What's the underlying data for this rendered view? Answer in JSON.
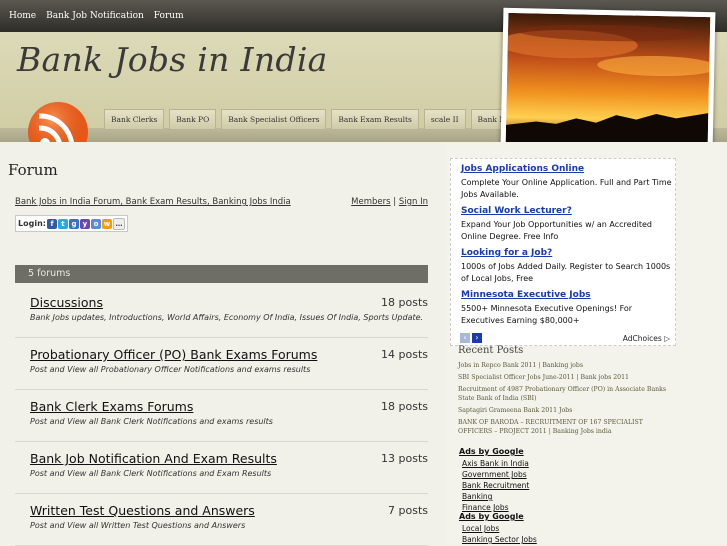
{
  "topnav": [
    "Home",
    "Bank Job Notification",
    "Forum"
  ],
  "header": {
    "site_title": "Bank Jobs in India",
    "categories": [
      "Bank Clerks",
      "Bank PO",
      "Bank Specialist Officers",
      "Bank Exam Results",
      "scale II",
      "Bank Manager"
    ]
  },
  "main": {
    "page_title": "Forum",
    "breadcrumb": "Bank Jobs in India Forum, Bank Exam Results, Banking Jobs India",
    "members_label": "Members",
    "separator": "|",
    "signin_label": "Sign In",
    "login_label": "Login:",
    "forums_header": "5 forums",
    "forums": [
      {
        "title": "Discussions",
        "desc": "Bank Jobs updates, Introductions, World Affairs, Economy Of India, Issues Of India, Sports Update.",
        "posts": "18 posts"
      },
      {
        "title": "Probationary Officer (PO) Bank Exams Forums",
        "desc": "Post and View all Probationary Officer Notifications and exams results",
        "posts": "14 posts"
      },
      {
        "title": "Bank Clerk Exams Forums",
        "desc": "Post and View all Bank Clerk Notifications and exams results",
        "posts": "18 posts"
      },
      {
        "title": "Bank Job Notification And Exam Results",
        "desc": "Post and View all Bank Clerk Notifications and Exam Results",
        "posts": "13 posts"
      },
      {
        "title": "Written Test Questions and Answers",
        "desc": "Post and View all Written Test Questions and Answers",
        "posts": "7 posts"
      }
    ]
  },
  "sidebar": {
    "ads": [
      {
        "title": "Jobs Applications Online",
        "body": "Complete Your Online Application. Full and Part Time Jobs Available."
      },
      {
        "title": "Social Work Lecturer?",
        "body": "Expand Your Job Opportunities w/ an Accredited Online Degree. Free Info"
      },
      {
        "title": "Looking for a Job?",
        "body": "1000s of Jobs Added Daily. Register to Search 1000s of Local Jobs, Free"
      },
      {
        "title": "Minnesota Executive Jobs",
        "body": "5500+ Minnesota Executive Openings! For Executives Earning $80,000+"
      }
    ],
    "adchoices": "AdChoices",
    "recent_title": "Recent Posts",
    "recent_posts": [
      "Jobs in Repco Bank 2011 | Banking jobs",
      "SBI Specialist Officer Jobs June-2011 | Bank jobs 2011",
      "Recruitment of 4987 Probationary Officer (PO) in Associate Banks State Bank of India (SBI)",
      "Saptagiri Grameena Bank 2011 Jobs",
      "BANK OF BARODA – RECRUITMENT OF 167 SPECIALIST OFFICERS – PROJECT 2011 | Banking Jobs india"
    ],
    "ads_by_google_1": "Ads by Google",
    "google_links_1": [
      "Axis Bank in India",
      "Government Jobs",
      "Bank Recruitment",
      "Banking",
      "Finance Jobs"
    ],
    "ads_by_google_2": "Ads by Google",
    "google_links_2": [
      "Local Jobs",
      "Banking Sector Jobs"
    ]
  }
}
